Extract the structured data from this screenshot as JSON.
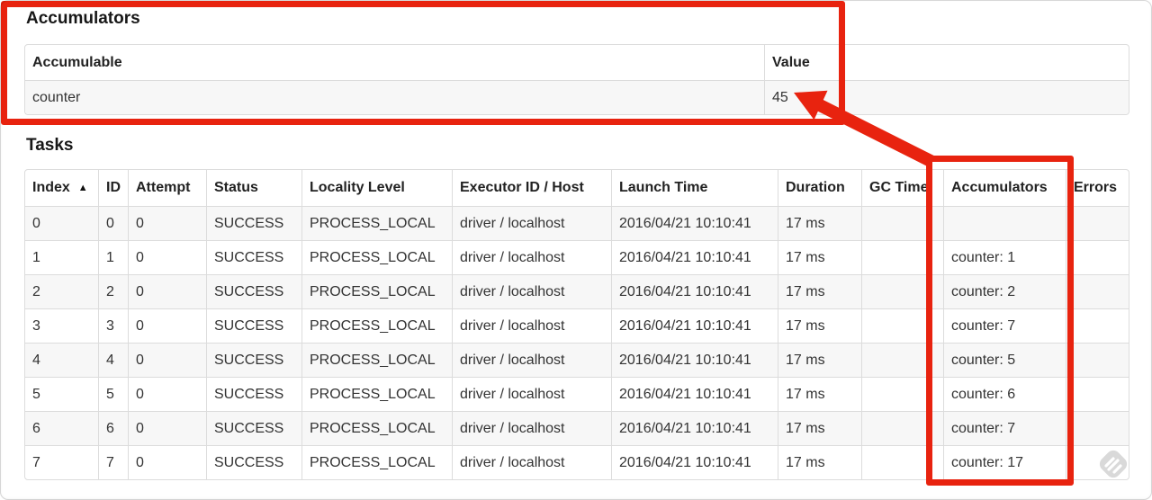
{
  "colors": {
    "annotation_red": "#e8230f",
    "table_border": "#dcdcdc",
    "row_stripe": "#f7f7f7",
    "watermark_gray": "#d9d9d9"
  },
  "accumulators_section": {
    "heading": "Accumulators",
    "table": {
      "headers": [
        "Accumulable",
        "Value"
      ],
      "rows": [
        {
          "accumulable": "counter",
          "value": "45"
        }
      ]
    }
  },
  "tasks_section": {
    "heading": "Tasks",
    "table": {
      "sorted_by": "index",
      "sort_indicator": "▲",
      "columns": [
        {
          "key": "index",
          "label": "Index"
        },
        {
          "key": "id",
          "label": "ID"
        },
        {
          "key": "attempt",
          "label": "Attempt"
        },
        {
          "key": "status",
          "label": "Status"
        },
        {
          "key": "locality_level",
          "label": "Locality Level"
        },
        {
          "key": "executor_id_host",
          "label": "Executor ID / Host"
        },
        {
          "key": "launch_time",
          "label": "Launch Time"
        },
        {
          "key": "duration",
          "label": "Duration"
        },
        {
          "key": "gc_time",
          "label": "GC Time"
        },
        {
          "key": "accumulators",
          "label": "Accumulators"
        },
        {
          "key": "errors",
          "label": "Errors"
        }
      ],
      "rows": [
        {
          "index": "0",
          "id": "0",
          "attempt": "0",
          "status": "SUCCESS",
          "locality_level": "PROCESS_LOCAL",
          "executor_id_host": "driver / localhost",
          "launch_time": "2016/04/21 10:10:41",
          "duration": "17 ms",
          "gc_time": "",
          "accumulators": "",
          "errors": ""
        },
        {
          "index": "1",
          "id": "1",
          "attempt": "0",
          "status": "SUCCESS",
          "locality_level": "PROCESS_LOCAL",
          "executor_id_host": "driver / localhost",
          "launch_time": "2016/04/21 10:10:41",
          "duration": "17 ms",
          "gc_time": "",
          "accumulators": "counter: 1",
          "errors": ""
        },
        {
          "index": "2",
          "id": "2",
          "attempt": "0",
          "status": "SUCCESS",
          "locality_level": "PROCESS_LOCAL",
          "executor_id_host": "driver / localhost",
          "launch_time": "2016/04/21 10:10:41",
          "duration": "17 ms",
          "gc_time": "",
          "accumulators": "counter: 2",
          "errors": ""
        },
        {
          "index": "3",
          "id": "3",
          "attempt": "0",
          "status": "SUCCESS",
          "locality_level": "PROCESS_LOCAL",
          "executor_id_host": "driver / localhost",
          "launch_time": "2016/04/21 10:10:41",
          "duration": "17 ms",
          "gc_time": "",
          "accumulators": "counter: 7",
          "errors": ""
        },
        {
          "index": "4",
          "id": "4",
          "attempt": "0",
          "status": "SUCCESS",
          "locality_level": "PROCESS_LOCAL",
          "executor_id_host": "driver / localhost",
          "launch_time": "2016/04/21 10:10:41",
          "duration": "17 ms",
          "gc_time": "",
          "accumulators": "counter: 5",
          "errors": ""
        },
        {
          "index": "5",
          "id": "5",
          "attempt": "0",
          "status": "SUCCESS",
          "locality_level": "PROCESS_LOCAL",
          "executor_id_host": "driver / localhost",
          "launch_time": "2016/04/21 10:10:41",
          "duration": "17 ms",
          "gc_time": "",
          "accumulators": "counter: 6",
          "errors": ""
        },
        {
          "index": "6",
          "id": "6",
          "attempt": "0",
          "status": "SUCCESS",
          "locality_level": "PROCESS_LOCAL",
          "executor_id_host": "driver / localhost",
          "launch_time": "2016/04/21 10:10:41",
          "duration": "17 ms",
          "gc_time": "",
          "accumulators": "counter: 7",
          "errors": ""
        },
        {
          "index": "7",
          "id": "7",
          "attempt": "0",
          "status": "SUCCESS",
          "locality_level": "PROCESS_LOCAL",
          "executor_id_host": "driver / localhost",
          "launch_time": "2016/04/21 10:10:41",
          "duration": "17 ms",
          "gc_time": "",
          "accumulators": "counter: 17",
          "errors": ""
        }
      ]
    }
  }
}
